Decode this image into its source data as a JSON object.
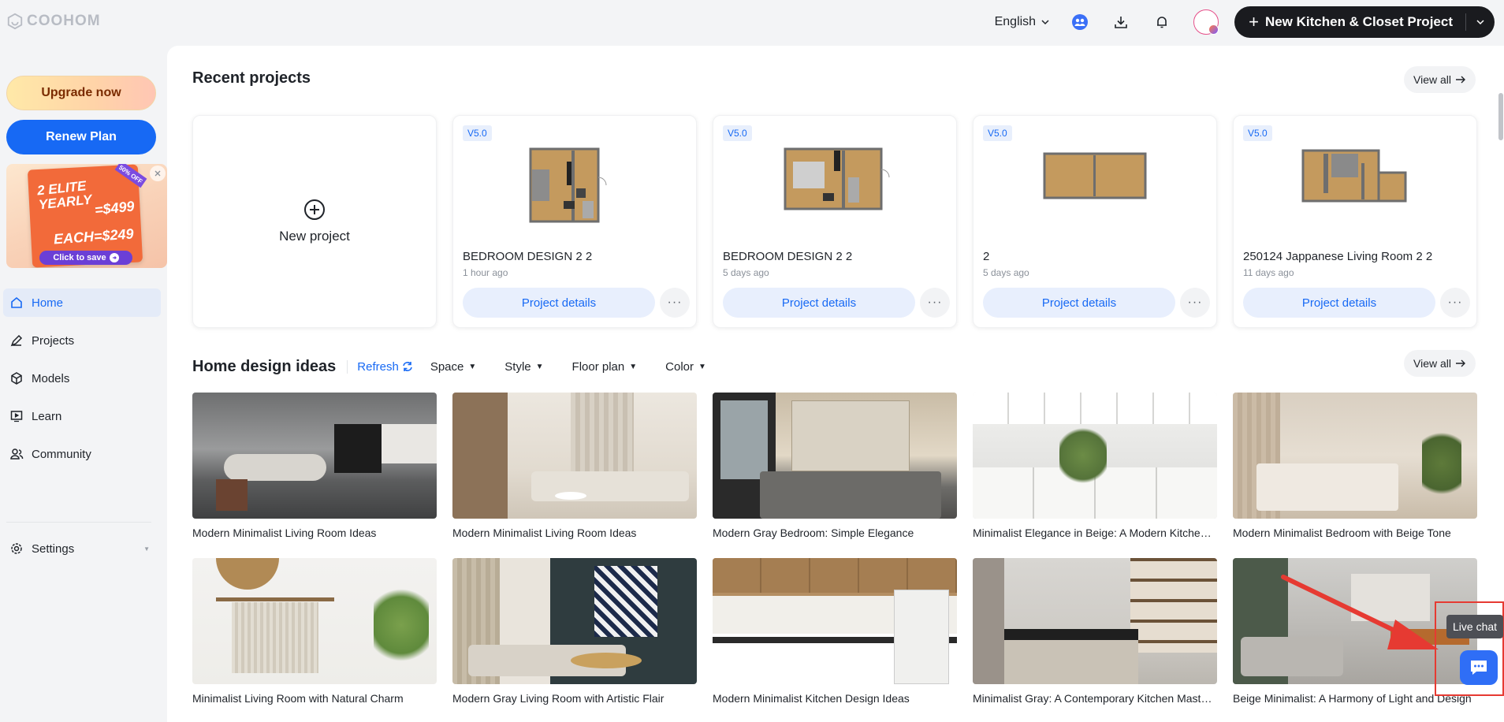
{
  "brand": {
    "name": "COOHOM"
  },
  "header": {
    "language": "English",
    "new_button_label": "New Kitchen & Closet Project"
  },
  "sidebar": {
    "upgrade_label": "Upgrade now",
    "renew_label": "Renew Plan",
    "promo": {
      "line1": "2 ELITE",
      "line2": "YEARLY",
      "price": "=$499",
      "each": "EACH=$249",
      "cta": "Click to save",
      "badge": "50% OFF"
    },
    "nav": [
      {
        "label": "Home",
        "icon": "home-icon",
        "active": true
      },
      {
        "label": "Projects",
        "icon": "projects-icon",
        "active": false
      },
      {
        "label": "Models",
        "icon": "cube-icon",
        "active": false
      },
      {
        "label": "Learn",
        "icon": "learn-icon",
        "active": false
      },
      {
        "label": "Community",
        "icon": "community-icon",
        "active": false
      },
      {
        "label": "Settings",
        "icon": "gear-icon",
        "active": false
      }
    ]
  },
  "recent": {
    "title": "Recent projects",
    "view_all": "View all",
    "new_project_label": "New project",
    "details_label": "Project details",
    "projects": [
      {
        "version": "V5.0",
        "name": "BEDROOM DESIGN 2 2",
        "time": "1 hour ago"
      },
      {
        "version": "V5.0",
        "name": "BEDROOM DESIGN 2 2",
        "time": "5 days ago"
      },
      {
        "version": "V5.0",
        "name": "2",
        "time": "5 days ago"
      },
      {
        "version": "V5.0",
        "name": "250124 Jappanese Living Room 2 2",
        "time": "11 days ago"
      }
    ]
  },
  "ideas": {
    "title": "Home design ideas",
    "refresh_label": "Refresh",
    "view_all": "View all",
    "filters": [
      "Space",
      "Style",
      "Floor plan",
      "Color"
    ],
    "items": [
      {
        "caption": "Modern Minimalist Living Room Ideas"
      },
      {
        "caption": "Modern Minimalist Living Room Ideas"
      },
      {
        "caption": "Modern Gray Bedroom: Simple Elegance"
      },
      {
        "caption": "Minimalist Elegance in Beige: A Modern Kitchen Design"
      },
      {
        "caption": "Modern Minimalist Bedroom with Beige Tone"
      },
      {
        "caption": "Minimalist Living Room with Natural Charm"
      },
      {
        "caption": "Modern Gray Living Room with Artistic Flair"
      },
      {
        "caption": "Modern Minimalist Kitchen Design Ideas"
      },
      {
        "caption": "Minimalist Gray: A Contemporary Kitchen Masterpiece"
      },
      {
        "caption": "Beige Minimalist: A Harmony of Light and Design"
      }
    ]
  },
  "live_chat": {
    "tooltip": "Live chat"
  }
}
